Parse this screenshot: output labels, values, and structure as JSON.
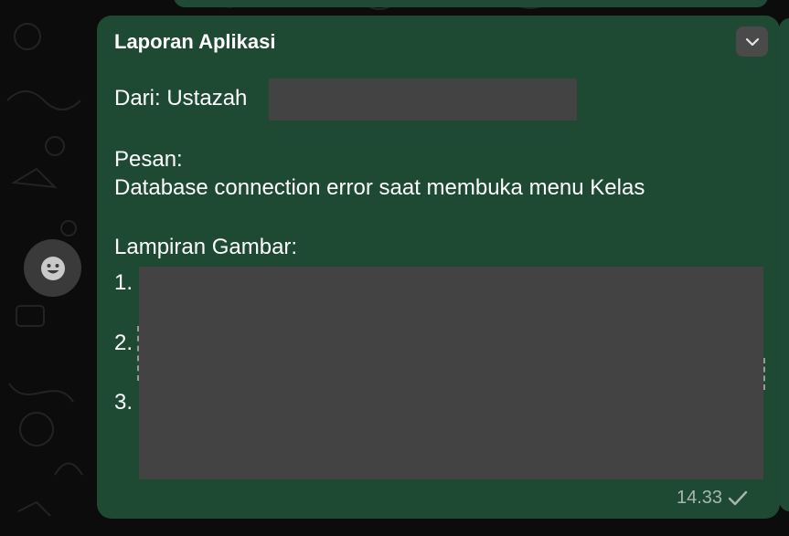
{
  "message": {
    "title": "Laporan Aplikasi",
    "from_label": "Dari: Ustazah",
    "pesan_label": "Pesan:",
    "pesan_text": "Database connection error saat membuka menu Kelas",
    "lampiran_label": "Lampiran Gambar:",
    "list_numbers": [
      "1.",
      "2.",
      "3."
    ],
    "time": "14.33",
    "status": "sent"
  },
  "icons": {
    "react": "emoji-smile-icon",
    "menu": "chevron-down-icon",
    "status": "checkmark-icon"
  },
  "colors": {
    "bubble": "#1e4a34",
    "background": "#0c0c0c",
    "redaction": "#434343"
  }
}
